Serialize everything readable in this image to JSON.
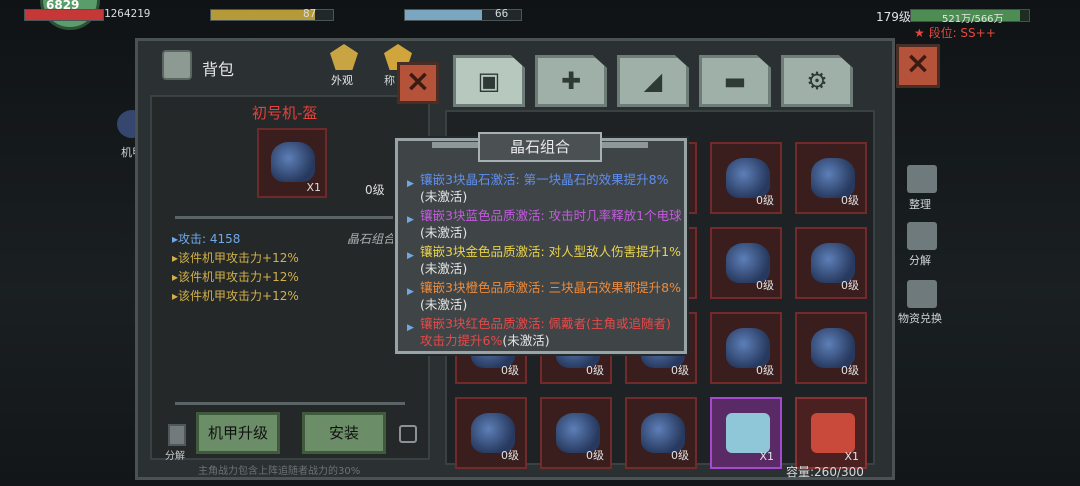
{
  "hud": {
    "avatar_number": "6829",
    "hp_value": "1264219",
    "food_value": "87",
    "water_value": "66",
    "player_level": "179级",
    "exp_text": "521万/566万",
    "exp_fraction": 0.92,
    "rank_text": "段位: SS++",
    "food_fraction": 0.85,
    "water_fraction": 0.66
  },
  "panel": {
    "bag_title": "背包",
    "look_label": "外观",
    "partial_label": "称",
    "mecha_label": "机甲",
    "tabs": [
      "backpack-icon",
      "medkit-icon",
      "food-icon",
      "gun-icon",
      "material-icon"
    ]
  },
  "item": {
    "name": "初号机-盔",
    "count": "X1",
    "level": "0级",
    "attack": "攻击: 4158",
    "bonuses": [
      "该件机甲攻击力+12%",
      "该件机甲攻击力+12%",
      "该件机甲攻击力+12%"
    ],
    "crystal_hint": "晶石组合",
    "upgrade_button": "机甲升级",
    "install_button": "安装",
    "discard_label": "分解",
    "footer_hint": "主角战力包含上阵追随者战力的30%"
  },
  "popup": {
    "title": "晶石组合",
    "effects": [
      {
        "text": "镶嵌3块晶石激活: 第一块晶石的效果提升8%",
        "status": "(未激活)",
        "color": "#5f8ff0"
      },
      {
        "text": "镶嵌3块蓝色品质激活: 攻击时几率释放1个电球",
        "status": "(未激活)",
        "color": "#c45ae0"
      },
      {
        "text": "镶嵌3块金色品质激活: 对人型敌人伤害提升1%",
        "status": "(未激活)",
        "color": "#e8d24a"
      },
      {
        "text": "镶嵌3块橙色品质激活: 三块晶石效果都提升8%",
        "status": "(未激活)",
        "color": "#ef8a3a"
      },
      {
        "text": "镶嵌3块红色品质激活: 佩戴者(主角或追随者)攻击力提升6%",
        "status": "(未激活)",
        "color": "#e84848"
      }
    ]
  },
  "grid": {
    "level_label": "0级",
    "x1_label": "X1",
    "capacity": "容量:260/300"
  },
  "side": {
    "sort_label": "整理",
    "split_label": "分解",
    "exchange_label": "物资兑换"
  }
}
